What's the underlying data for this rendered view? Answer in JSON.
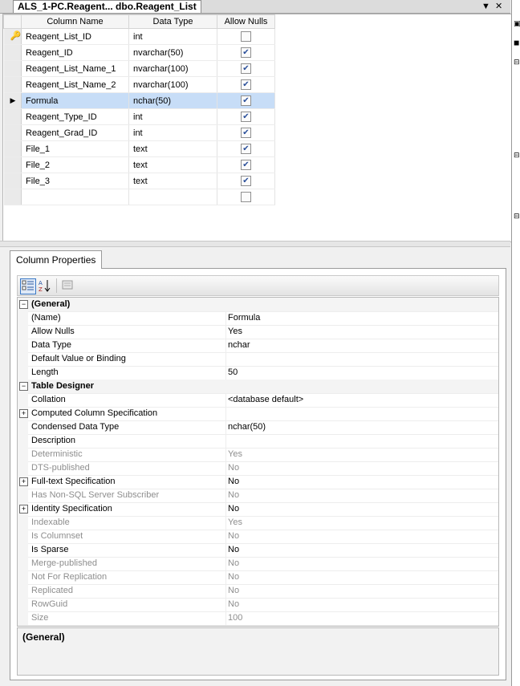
{
  "document_tab": {
    "title": "ALS_1-PC.Reagent... dbo.Reagent_List",
    "dropdown_glyph": "▼",
    "close_glyph": "✕"
  },
  "columns_grid": {
    "headers": [
      "Column Name",
      "Data Type",
      "Allow Nulls"
    ],
    "rows": [
      {
        "name": "Reagent_List_ID",
        "type": "int",
        "allow_nulls": false,
        "marker": "primary-key"
      },
      {
        "name": "Reagent_ID",
        "type": "nvarchar(50)",
        "allow_nulls": true
      },
      {
        "name": "Reagent_List_Name_1",
        "type": "nvarchar(100)",
        "allow_nulls": true
      },
      {
        "name": "Reagent_List_Name_2",
        "type": "nvarchar(100)",
        "allow_nulls": true
      },
      {
        "name": "Formula",
        "type": "nchar(50)",
        "allow_nulls": true,
        "marker": "current-row"
      },
      {
        "name": "Reagent_Type_ID",
        "type": "int",
        "allow_nulls": true
      },
      {
        "name": "Reagent_Grad_ID",
        "type": "int",
        "allow_nulls": true
      },
      {
        "name": "File_1",
        "type": "text",
        "allow_nulls": true
      },
      {
        "name": "File_2",
        "type": "text",
        "allow_nulls": true
      },
      {
        "name": "File_3",
        "type": "text",
        "allow_nulls": true
      },
      {
        "name": "",
        "type": "",
        "allow_nulls": false
      }
    ],
    "check_glyph": "✔",
    "key_glyph": "🔑",
    "arrow_glyph": "▶"
  },
  "column_properties": {
    "tab_label": "Column Properties",
    "toolbar": {
      "categorized_icon": "categorized-view-icon",
      "alphabetical_icon": "alphabetical-sort-icon",
      "property_pages_icon": "property-pages-icon",
      "alpha_glyph": "A↓Z"
    },
    "rows": [
      {
        "kind": "category",
        "name": "(General)",
        "expander": "⊟"
      },
      {
        "kind": "prop",
        "name": "(Name)",
        "value": "Formula"
      },
      {
        "kind": "prop",
        "name": "Allow Nulls",
        "value": "Yes"
      },
      {
        "kind": "prop",
        "name": "Data Type",
        "value": "nchar"
      },
      {
        "kind": "prop",
        "name": "Default Value or Binding",
        "value": ""
      },
      {
        "kind": "prop",
        "name": "Length",
        "value": "50"
      },
      {
        "kind": "category",
        "name": "Table Designer",
        "expander": "⊟"
      },
      {
        "kind": "prop",
        "name": "Collation",
        "value": "<database default>"
      },
      {
        "kind": "prop",
        "name": "Computed Column Specification",
        "value": "",
        "expander": "+"
      },
      {
        "kind": "prop",
        "name": "Condensed Data Type",
        "value": "nchar(50)"
      },
      {
        "kind": "prop",
        "name": "Description",
        "value": ""
      },
      {
        "kind": "readonly",
        "name": "Deterministic",
        "value": "Yes"
      },
      {
        "kind": "readonly",
        "name": "DTS-published",
        "value": "No"
      },
      {
        "kind": "prop",
        "name": "Full-text Specification",
        "value": "No",
        "expander": "+"
      },
      {
        "kind": "readonly",
        "name": "Has Non-SQL Server Subscriber",
        "value": "No"
      },
      {
        "kind": "prop",
        "name": "Identity Specification",
        "value": "No",
        "expander": "+"
      },
      {
        "kind": "readonly",
        "name": "Indexable",
        "value": "Yes"
      },
      {
        "kind": "readonly",
        "name": "Is Columnset",
        "value": "No"
      },
      {
        "kind": "prop",
        "name": "Is Sparse",
        "value": "No"
      },
      {
        "kind": "readonly",
        "name": "Merge-published",
        "value": "No"
      },
      {
        "kind": "readonly",
        "name": "Not For Replication",
        "value": "No"
      },
      {
        "kind": "readonly",
        "name": "Replicated",
        "value": "No"
      },
      {
        "kind": "readonly",
        "name": "RowGuid",
        "value": "No"
      },
      {
        "kind": "readonly",
        "name": "Size",
        "value": "100"
      }
    ],
    "description_title": "(General)"
  },
  "right_strip": {
    "marks": [
      "▣",
      "◼",
      "⊟",
      "⊟",
      "⊟"
    ]
  }
}
